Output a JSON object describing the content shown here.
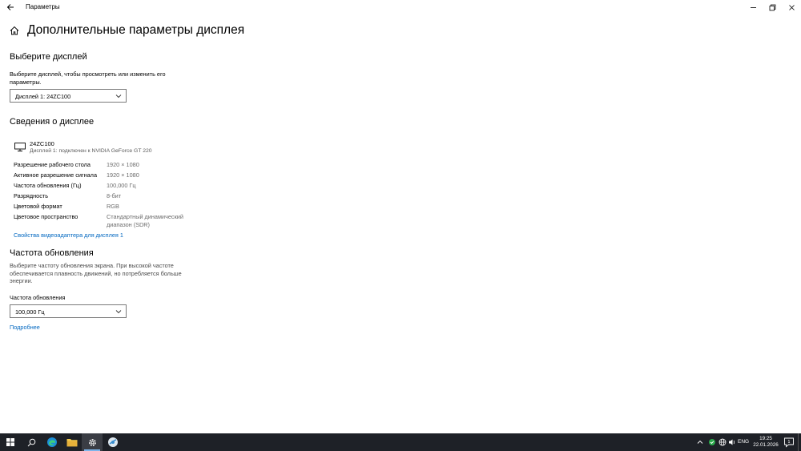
{
  "window": {
    "title": "Параметры"
  },
  "page": {
    "title": "Дополнительные параметры дисплея"
  },
  "select_display": {
    "heading": "Выберите дисплей",
    "description": "Выберите дисплей, чтобы просмотреть или изменить его параметры.",
    "selected": "Дисплей 1: 24ZC100"
  },
  "display_info": {
    "heading": "Сведения о дисплее",
    "monitor_name": "24ZC100",
    "monitor_sub": "Дисплей 1: подключен к NVIDIA GeForce GT 220",
    "rows": [
      {
        "key": "Разрешение рабочего стола",
        "value": "1920 × 1080"
      },
      {
        "key": "Активное разрешение сигнала",
        "value": "1920 × 1080"
      },
      {
        "key": "Частота обновления (Гц)",
        "value": "100,000 Гц"
      },
      {
        "key": "Разрядность",
        "value": "8-бит"
      },
      {
        "key": "Цветовой формат",
        "value": "RGB"
      },
      {
        "key": "Цветовое пространство",
        "value": "Стандартный динамический диапазон (SDR)"
      }
    ],
    "adapter_link": "Свойства видеоадаптера для дисплея 1"
  },
  "refresh": {
    "heading": "Частота обновления",
    "description": "Выберите частоту обновления экрана. При высокой частоте обеспечивается плавность движений, но потребляется больше энергии.",
    "label": "Частота обновления",
    "selected": "100,000 Гц",
    "more_link": "Подробнее"
  },
  "taskbar": {
    "language": "ENG",
    "time": "19:25",
    "date": "22.01.2026",
    "notification_count": "1",
    "pinned_icons": [
      "start-icon",
      "search-icon",
      "edge-icon",
      "file-explorer-icon",
      "settings-icon",
      "app-icon"
    ],
    "tray_icons": [
      "chevron-up-icon",
      "network-icon",
      "globe-icon",
      "volume-icon"
    ]
  },
  "colors": {
    "accent_link": "#0067c0",
    "taskbar_bg": "#1e2127",
    "active_indicator": "#7db4ea"
  }
}
